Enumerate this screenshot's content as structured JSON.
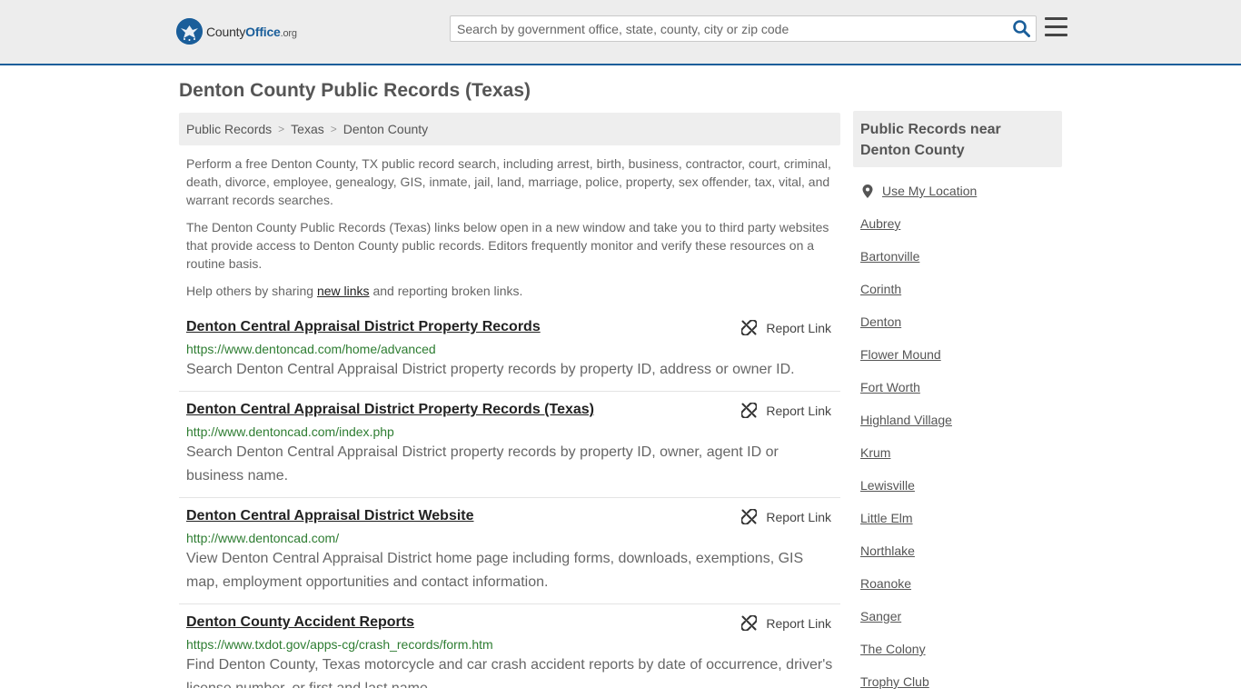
{
  "header": {
    "logo": {
      "part1": "County",
      "part2": "Office",
      "part3": ".org"
    },
    "search": {
      "placeholder": "Search by government office, state, county, city or zip code",
      "value": ""
    },
    "colors": {
      "brand": "#1a5e9a",
      "header_bg": "#ededed"
    },
    "icons": {
      "search": "search-icon",
      "menu": "menu-icon"
    }
  },
  "page": {
    "title": "Denton County Public Records (Texas)",
    "breadcrumb": [
      "Public Records",
      "Texas",
      "Denton County"
    ],
    "intro": {
      "p1": "Perform a free Denton County, TX public record search, including arrest, birth, business, contractor, court, criminal, death, divorce, employee, genealogy, GIS, inmate, jail, land, marriage, police, property, sex offender, tax, vital, and warrant records searches.",
      "p2": "The Denton County Public Records (Texas) links below open in a new window and take you to third party websites that provide access to Denton County public records. Editors frequently monitor and verify these resources on a routine basis.",
      "p3_before": "Help others by sharing ",
      "p3_link": "new links",
      "p3_after": " and reporting broken links."
    }
  },
  "records": [
    {
      "title": "Denton Central Appraisal District Property Records",
      "url": "https://www.dentoncad.com/home/advanced",
      "description": "Search Denton Central Appraisal District property records by property ID, address or owner ID.",
      "report_label": "Report Link"
    },
    {
      "title": "Denton Central Appraisal District Property Records (Texas)",
      "url": "http://www.dentoncad.com/index.php",
      "description": "Search Denton Central Appraisal District property records by property ID, owner, agent ID or business name.",
      "report_label": "Report Link"
    },
    {
      "title": "Denton Central Appraisal District Website",
      "url": "http://www.dentoncad.com/",
      "description": "View Denton Central Appraisal District home page including forms, downloads, exemptions, GIS map, employment opportunities and contact information.",
      "report_label": "Report Link"
    },
    {
      "title": "Denton County Accident Reports",
      "url": "https://www.txdot.gov/apps-cg/crash_records/form.htm",
      "description": "Find Denton County, Texas motorcycle and car crash accident reports by date of occurrence, driver's license number, or first and last name.",
      "report_label": "Report Link"
    }
  ],
  "sidebar": {
    "heading": "Public Records near Denton County",
    "use_location": "Use My Location",
    "cities": [
      "Aubrey",
      "Bartonville",
      "Corinth",
      "Denton",
      "Flower Mound",
      "Fort Worth",
      "Highland Village",
      "Krum",
      "Lewisville",
      "Little Elm",
      "Northlake",
      "Roanoke",
      "Sanger",
      "The Colony",
      "Trophy Club"
    ]
  }
}
